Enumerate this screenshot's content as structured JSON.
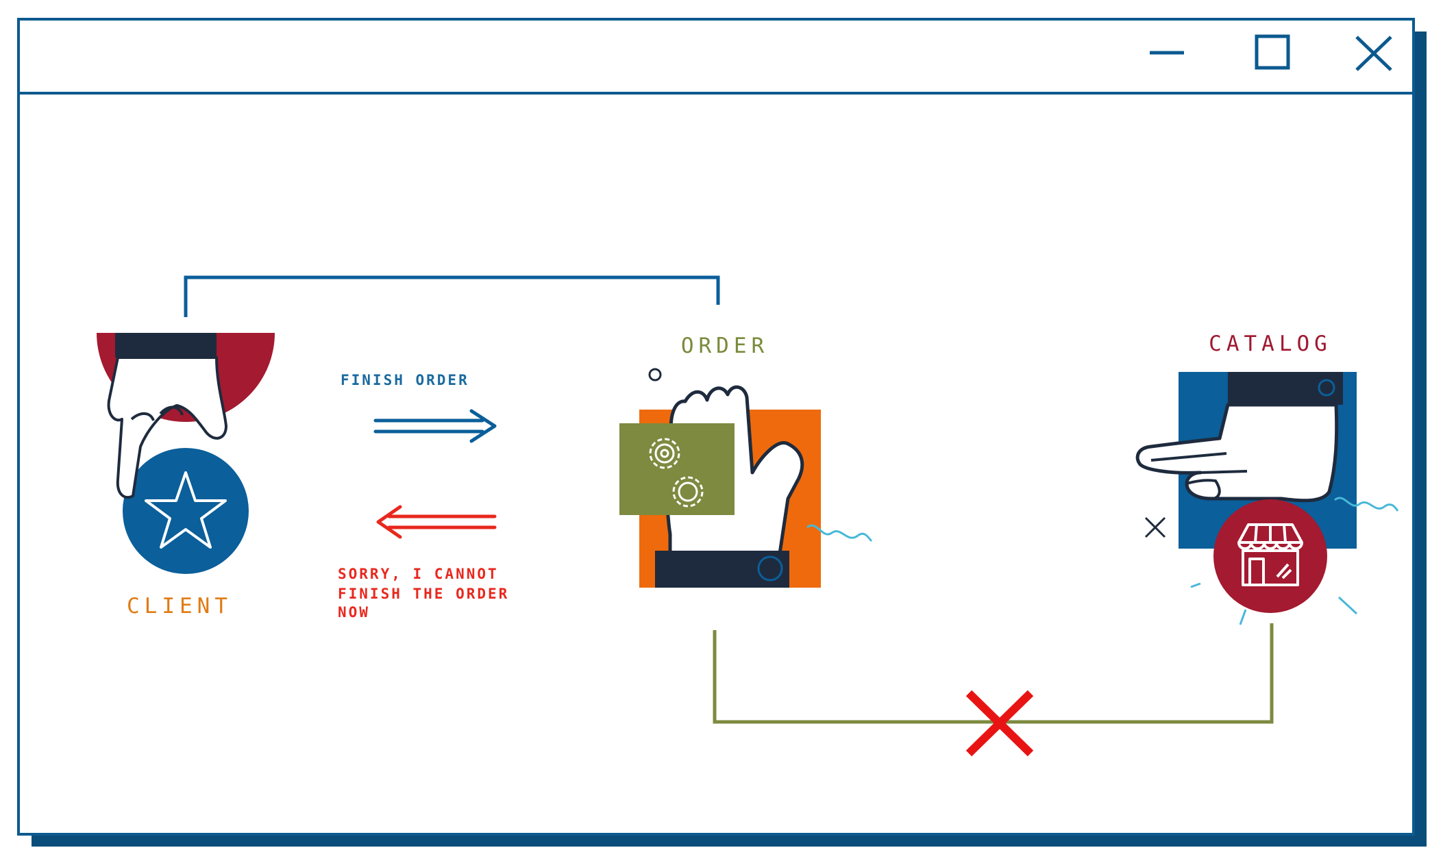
{
  "window": {
    "controls": {
      "minimize": "minimize-icon",
      "maximize": "maximize-icon",
      "close": "close-icon"
    }
  },
  "nodes": {
    "client": {
      "label": "CLIENT",
      "icon": "star-icon"
    },
    "order": {
      "label": "ORDER",
      "icon": "gears-icon"
    },
    "catalog": {
      "label": "CATALOG",
      "icon": "store-icon"
    }
  },
  "messages": {
    "request": "FINISH ORDER",
    "response": [
      "SORRY, I CANNOT",
      "FINISH THE ORDER",
      "NOW"
    ]
  },
  "connections": {
    "client_order": "connected",
    "order_catalog": "broken"
  },
  "colors": {
    "window_border": "#0b5a8f",
    "window_shadow": "#0b4d7a",
    "client_label": "#e07b14",
    "order_label": "#7a8a3c",
    "catalog_label": "#a01830",
    "request_text": "#1a6aa0",
    "response_text": "#e8281e",
    "navy": "#1e2b3e",
    "blue": "#0b5f9a",
    "crimson": "#a41a30",
    "orange": "#ee6a0c",
    "olive": "#7d8a40",
    "cyan": "#48b8d8",
    "red_x": "#e81414"
  }
}
